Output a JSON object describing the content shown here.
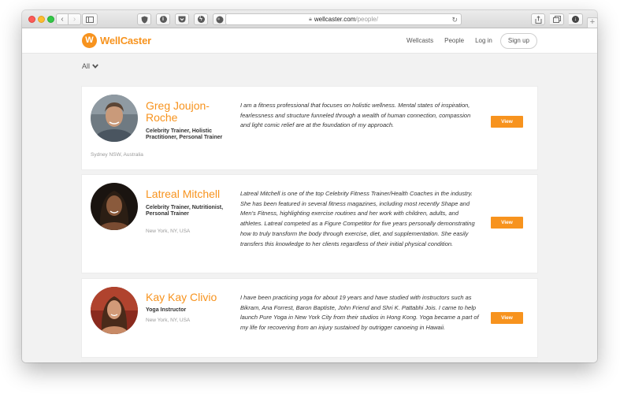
{
  "browser": {
    "url_host": "wellcaster.com",
    "url_path": "/people/",
    "new_tab_label": "+"
  },
  "site": {
    "logo_text": "WellCaster",
    "nav": [
      "Wellcasts",
      "People",
      "Log in"
    ],
    "signup_label": "Sign up"
  },
  "filter": {
    "label": "All"
  },
  "people": [
    {
      "name": "Greg Joujon-Roche",
      "title": "Celebrity Trainer, Holistic Practitioner, Personal Trainer",
      "location": "Sydney NSW, Australia",
      "bio": "I am a fitness professional that focuses on holistic wellness. Mental states of inspiration, fearlessness and structure funneled through a wealth of human connection, compassion and light comic relief are at the foundation of my approach.",
      "view_label": "View"
    },
    {
      "name": "Latreal Mitchell",
      "title": "Celebrity Trainer, Nutritionist, Personal Trainer",
      "location": "New York, NY, USA",
      "bio": "Latreal Mitchell is one of the top Celebrity Fitness Trainer/Health Coaches in the industry. She has been featured in several fitness magazines, including most recently Shape and Men's Fitness, highlighting exercise routines and her work with children, adults, and athletes. Latreal competed as a Figure Competitor for five years personally demonstrating how to truly transform the body through exercise, diet, and supplementation. She easily transfers this knowledge to her clients regardless of their initial physical condition.",
      "view_label": "View"
    },
    {
      "name": "Kay Kay Clivio",
      "title": "Yoga Instructor",
      "location": "New York, NY, USA",
      "bio": "I have been practicing yoga for about 19 years and have studied with instructors such as Bikram, Ana Forrest, Baron Baptiste, John Friend and Shri K. Pattabhi Jois. I came to help launch Pure Yoga in New York City from their studios in Hong Kong. Yoga became a part of my life for recovering from an injury sustained by outrigger canoeing in Hawaii.",
      "view_label": "View"
    }
  ]
}
